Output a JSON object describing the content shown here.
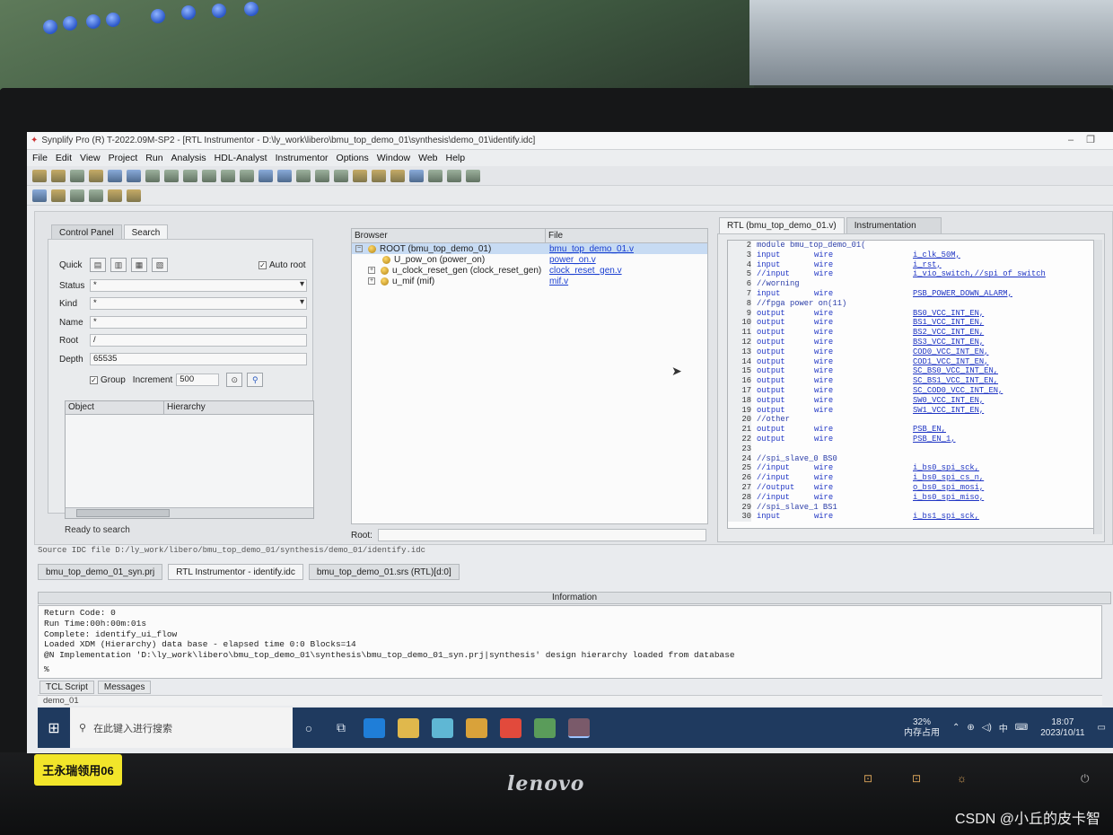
{
  "window": {
    "title": "Synplify Pro (R) T-2022.09M-SP2 - [RTL Instrumentor - D:\\ly_work\\libero\\bmu_top_demo_01\\synthesis\\demo_01\\identify.idc]"
  },
  "menu": [
    "File",
    "Edit",
    "View",
    "Project",
    "Run",
    "Analysis",
    "HDL-Analyst",
    "Instrumentor",
    "Options",
    "Window",
    "Web",
    "Help"
  ],
  "left_panel": {
    "tabs": [
      "Control Panel",
      "Search"
    ],
    "quick_label": "Quick",
    "auto_root_label": "Auto root",
    "status_label": "Status",
    "status_value": "*",
    "kind_label": "Kind",
    "kind_value": "*",
    "name_label": "Name",
    "name_value": "*",
    "root_label": "Root",
    "root_value": "/",
    "depth_label": "Depth",
    "depth_value": "65535",
    "group_label": "Group",
    "increment_label": "Increment",
    "increment_value": "500",
    "columns": [
      "Object",
      "Hierarchy"
    ],
    "status_text": "Ready to search"
  },
  "browser": {
    "columns": [
      "Browser",
      "File"
    ],
    "rows": [
      {
        "node": "ROOT (bmu_top_demo_01)",
        "file": "bmu_top_demo_01.v"
      },
      {
        "node": "U_pow_on (power_on)",
        "file": "power_on.v"
      },
      {
        "node": "u_clock_reset_gen (clock_reset_gen)",
        "file": "clock_reset_gen.v"
      },
      {
        "node": "u_mif (mif)",
        "file": "mif.v"
      }
    ],
    "root_label": "Root:"
  },
  "code_panel": {
    "tabs": [
      "RTL (bmu_top_demo_01.v)",
      "Instrumentation"
    ],
    "lines": [
      {
        "n": "2",
        "a": "module bmu_top_demo_01(",
        "b": "",
        "c": ""
      },
      {
        "n": "3",
        "a": "input",
        "b": "wire",
        "c": "i_clk_50M,"
      },
      {
        "n": "4",
        "a": "input",
        "b": "wire",
        "c": "i_rst,"
      },
      {
        "n": "5",
        "a": "//input",
        "b": "wire",
        "c": "i_vio_switch,//spi of switch"
      },
      {
        "n": "6",
        "a": "//worning",
        "b": "",
        "c": ""
      },
      {
        "n": "7",
        "a": "input",
        "b": "wire",
        "c": "PSB_POWER_DOWN_ALARM,"
      },
      {
        "n": "8",
        "a": "//fpga power on(11)",
        "b": "",
        "c": ""
      },
      {
        "n": "9",
        "a": "output",
        "b": "wire",
        "c": "BS0_VCC_INT_EN,"
      },
      {
        "n": "10",
        "a": "output",
        "b": "wire",
        "c": "BS1_VCC_INT_EN,"
      },
      {
        "n": "11",
        "a": "output",
        "b": "wire",
        "c": "BS2_VCC_INT_EN,"
      },
      {
        "n": "12",
        "a": "output",
        "b": "wire",
        "c": "BS3_VCC_INT_EN,"
      },
      {
        "n": "13",
        "a": "output",
        "b": "wire",
        "c": "COD0_VCC_INT_EN,"
      },
      {
        "n": "14",
        "a": "output",
        "b": "wire",
        "c": "COD1_VCC_INT_EN,"
      },
      {
        "n": "15",
        "a": "output",
        "b": "wire",
        "c": "SC_BS0_VCC_INT_EN,"
      },
      {
        "n": "16",
        "a": "output",
        "b": "wire",
        "c": "SC_BS1_VCC_INT_EN,"
      },
      {
        "n": "17",
        "a": "output",
        "b": "wire",
        "c": "SC_COD0_VCC_INT_EN,"
      },
      {
        "n": "18",
        "a": "output",
        "b": "wire",
        "c": "SW0_VCC_INT_EN,"
      },
      {
        "n": "19",
        "a": "output",
        "b": "wire",
        "c": "SW1_VCC_INT_EN,"
      },
      {
        "n": "20",
        "a": "//other",
        "b": "",
        "c": ""
      },
      {
        "n": "21",
        "a": "output",
        "b": "wire",
        "c": "PSB_EN,"
      },
      {
        "n": "22",
        "a": "output",
        "b": "wire",
        "c": "PSB_EN_1,"
      },
      {
        "n": "23",
        "a": "",
        "b": "",
        "c": ""
      },
      {
        "n": "24",
        "a": "//spi_slave_0 BS0",
        "b": "",
        "c": ""
      },
      {
        "n": "25",
        "a": "//input",
        "b": "wire",
        "c": "i_bs0_spi_sck,"
      },
      {
        "n": "26",
        "a": "//input",
        "b": "wire",
        "c": "i_bs0_spi_cs_n,"
      },
      {
        "n": "27",
        "a": "//output",
        "b": "wire",
        "c": "o_bs0_spi_mosi,"
      },
      {
        "n": "28",
        "a": "//input",
        "b": "wire",
        "c": "i_bs0_spi_miso,"
      },
      {
        "n": "29",
        "a": "//spi_slave_1 BS1",
        "b": "",
        "c": ""
      },
      {
        "n": "30",
        "a": "input",
        "b": "wire",
        "c": "i_bs1_spi_sck,"
      }
    ]
  },
  "source_line": "Source IDC file D:/ly_work/libero/bmu_top_demo_01/synthesis/demo_01/identify.idc",
  "doc_tabs": [
    "bmu_top_demo_01_syn.prj",
    "RTL Instrumentor - identify.idc",
    "bmu_top_demo_01.srs (RTL)[d:0]"
  ],
  "info": {
    "title": "Information",
    "log": [
      "Return Code: 0",
      "Run Time:00h:00m:01s",
      "Complete: identify_ui_flow",
      "Loaded XDM (Hierarchy) data base - elapsed time 0:0 Blocks=14",
      "@N Implementation 'D:\\ly_work\\libero\\bmu_top_demo_01\\synthesis\\bmu_top_demo_01_syn.prj|synthesis' design hierarchy loaded from database",
      "%"
    ],
    "tabs": [
      "TCL Script",
      "Messages"
    ],
    "status": "demo_01"
  },
  "taskbar": {
    "search_placeholder": "在此键入进行搜索",
    "mem_percent": "32%",
    "mem_label": "内存占用",
    "ime": "中",
    "time": "18:07",
    "date": "2023/10/11"
  },
  "scene": {
    "sticker": "王永瑞领用06",
    "brand": "lenovo",
    "watermark": "CSDN @小丘的皮卡智"
  }
}
